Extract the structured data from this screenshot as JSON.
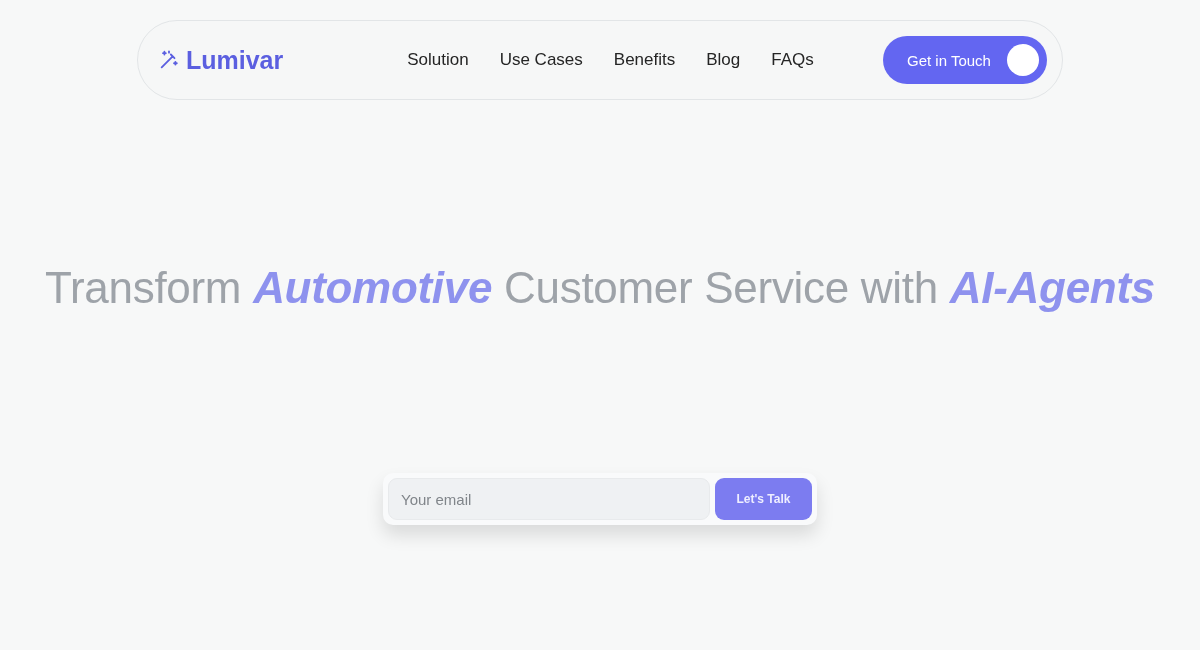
{
  "brand": {
    "name": "Lumivar"
  },
  "nav": {
    "links": [
      "Solution",
      "Use Cases",
      "Benefits",
      "Blog",
      "FAQs"
    ],
    "cta": "Get in Touch"
  },
  "hero": {
    "headline": "Transform *Automotive* Customer Service with *AI-Agents*"
  },
  "signup": {
    "placeholder": "Your email",
    "button": "Let's Talk"
  }
}
